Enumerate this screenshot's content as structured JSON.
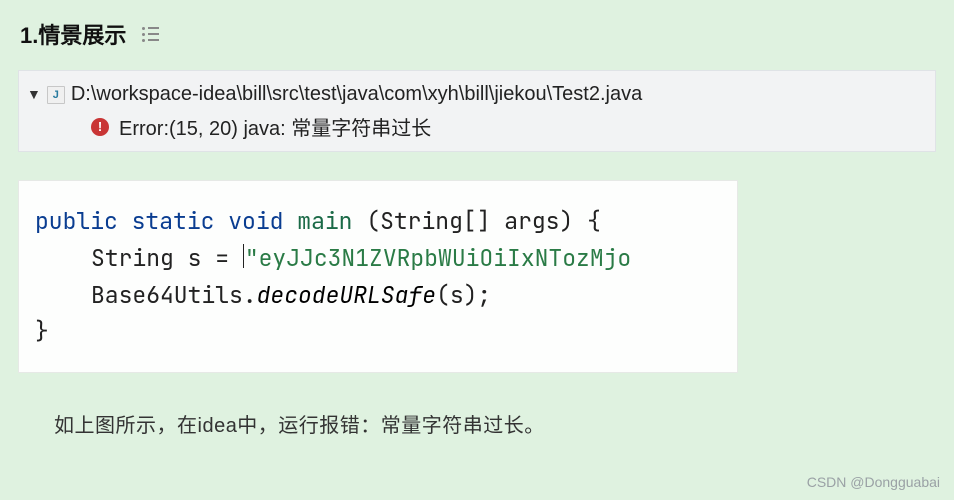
{
  "heading": "1.情景展示",
  "errorPanel": {
    "filePath": "D:\\workspace-idea\\bill\\src\\test\\java\\com\\xyh\\bill\\jiekou\\Test2.java",
    "errorText": "Error:(15, 20)  java: 常量字符串过长"
  },
  "code": {
    "kw_public": "public",
    "kw_static": "static",
    "kw_void": "void",
    "fn_main": "main",
    "sig_params": "(String[] args) {",
    "line2_left": "String s = ",
    "line2_str": "\"eyJJc3N1ZVRpbWUiOiIxNTozMjo",
    "line3_left": "Base64Utils.",
    "line3_fn": "decodeURLSafe",
    "line3_right": "(s);",
    "line4": "}"
  },
  "explain": "如上图所示，在idea中，运行报错：常量字符串过长。",
  "watermark": "CSDN @Dongguabai"
}
